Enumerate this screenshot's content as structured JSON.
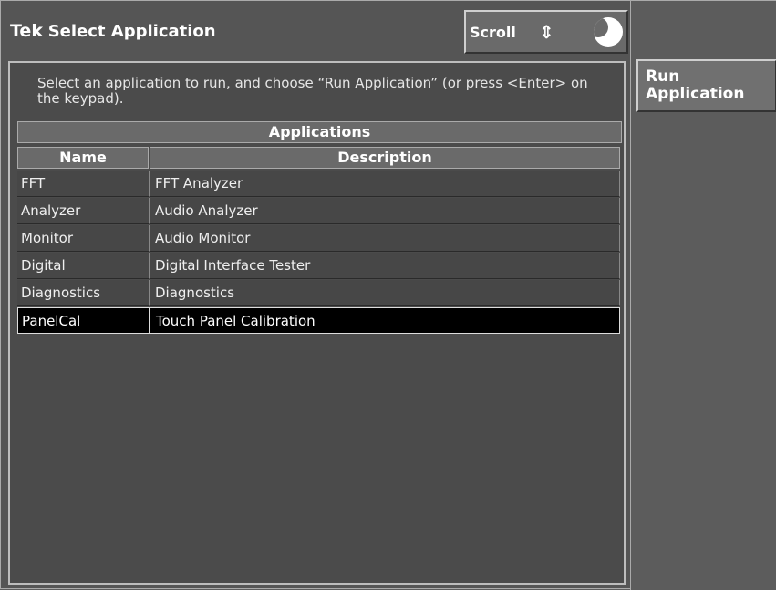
{
  "title": {
    "brand": "Tek",
    "text": "Select Application"
  },
  "scroll": {
    "label": "Scroll",
    "arrows": "⇕"
  },
  "run_button": {
    "label": "Run\nApplication"
  },
  "instruction": "Select an application to run, and choose “Run Application” (or press <Enter> on the keypad).",
  "table": {
    "title": "Applications",
    "columns": [
      "Name",
      "Description"
    ],
    "rows": [
      {
        "name": "FFT",
        "description": "FFT Analyzer"
      },
      {
        "name": "Analyzer",
        "description": "Audio Analyzer"
      },
      {
        "name": "Monitor",
        "description": "Audio Monitor"
      },
      {
        "name": "Digital",
        "description": "Digital Interface Tester"
      },
      {
        "name": "Diagnostics",
        "description": "Diagnostics"
      },
      {
        "name": "PanelCal",
        "description": "Touch Panel Calibration"
      }
    ],
    "selected_row": 5
  },
  "colors": {
    "background": "#555555",
    "selected": "#000000",
    "text": "#ffffff"
  }
}
